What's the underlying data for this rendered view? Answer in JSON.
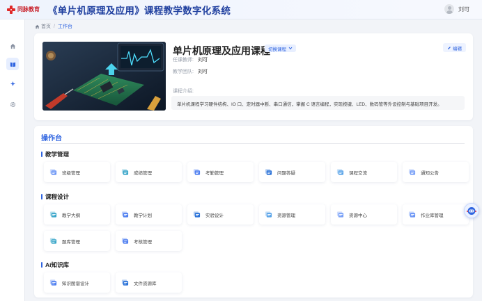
{
  "header": {
    "logo_text": "同脉教育",
    "title": "《单片机原理及应用》课程教学数字化系统",
    "user_name": "刘可"
  },
  "sidebar": {
    "items": [
      {
        "icon": "home-icon",
        "active": false
      },
      {
        "icon": "book-icon",
        "active": true
      },
      {
        "icon": "sparkle-icon",
        "active": false
      },
      {
        "icon": "gear-icon",
        "active": false
      }
    ]
  },
  "breadcrumb": {
    "home": "首页",
    "separator": "/",
    "current": "工作台"
  },
  "course": {
    "name": "单片机原理及应用课程",
    "switch_label": "切换课程",
    "edit_label": "编辑",
    "teacher_label": "任课教师:",
    "teacher_value": "刘可",
    "team_label": "教学团队:",
    "team_value": "刘可",
    "intro_label": "课程介绍:",
    "intro_text": "单片机课程学习硬件结构、IO 口、定时器中断、串口通信，掌握 C 语言编程，实现按键、LED、数码管等外设控制与基础项目开发。"
  },
  "ops": {
    "title": "操作台",
    "sections": [
      {
        "title": "教学管理",
        "items": [
          {
            "label": "班级管理",
            "icon": "class-icon"
          },
          {
            "label": "成绩管理",
            "icon": "grade-icon"
          },
          {
            "label": "考勤管理",
            "icon": "attendance-icon"
          },
          {
            "label": "问题答疑",
            "icon": "qa-icon"
          },
          {
            "label": "课程交流",
            "icon": "discussion-icon"
          },
          {
            "label": "通知公告",
            "icon": "notice-icon"
          }
        ]
      },
      {
        "title": "课程设计",
        "items": [
          {
            "label": "教学大纲",
            "icon": "syllabus-icon"
          },
          {
            "label": "教学计划",
            "icon": "plan-icon"
          },
          {
            "label": "实验设计",
            "icon": "experiment-icon"
          },
          {
            "label": "资源管理",
            "icon": "resource-icon"
          },
          {
            "label": "资源中心",
            "icon": "resource-center-icon"
          },
          {
            "label": "作业库管理",
            "icon": "homework-icon"
          },
          {
            "label": "题库管理",
            "icon": "question-bank-icon"
          },
          {
            "label": "考核管理",
            "icon": "exam-icon"
          }
        ]
      },
      {
        "title": "Ai知识库",
        "items": [
          {
            "label": "知识图谱设计",
            "icon": "knowledge-graph-icon"
          },
          {
            "label": "文件资源库",
            "icon": "file-library-icon"
          }
        ]
      }
    ]
  },
  "colors": {
    "accent": "#2f64e0",
    "title_blue": "#1f3f9f",
    "logo_red": "#c8202a",
    "icon_light": "#8fb2ff",
    "icon_teal": "#3aa6c9"
  }
}
